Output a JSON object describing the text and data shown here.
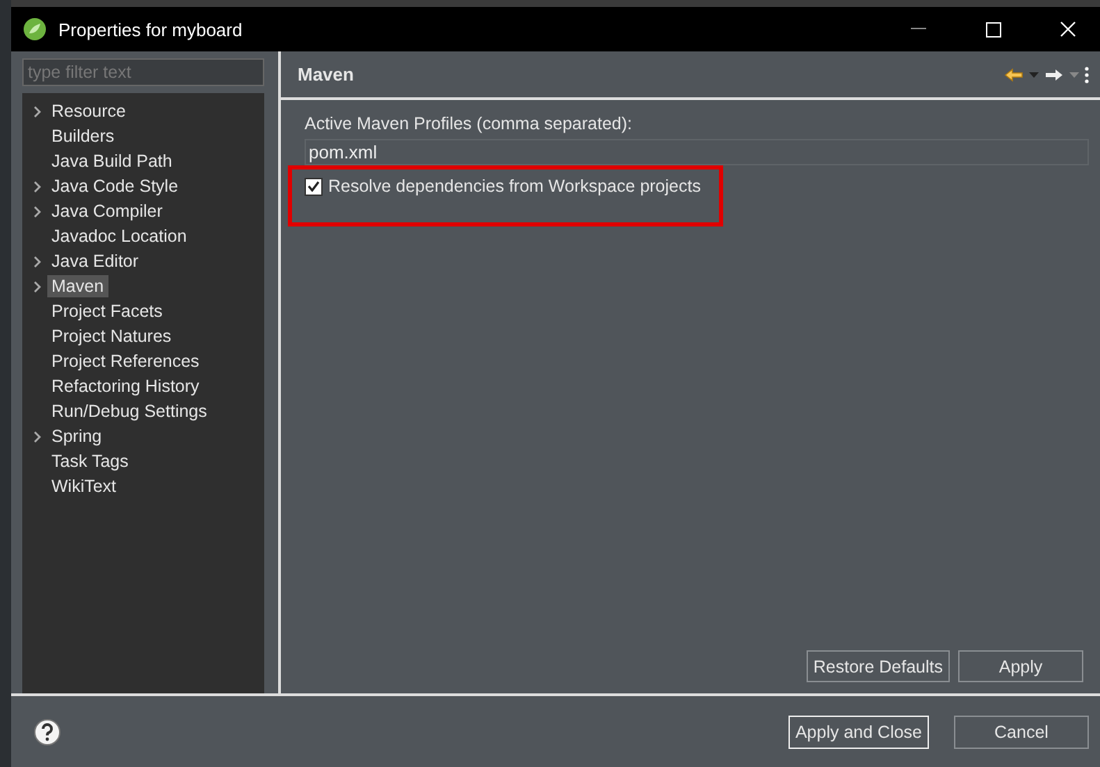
{
  "window": {
    "title": "Properties for myboard"
  },
  "filter": {
    "placeholder": "type filter text"
  },
  "tree": [
    {
      "label": "Resource",
      "expandable": true,
      "selected": false
    },
    {
      "label": "Builders",
      "expandable": false,
      "selected": false
    },
    {
      "label": "Java Build Path",
      "expandable": false,
      "selected": false
    },
    {
      "label": "Java Code Style",
      "expandable": true,
      "selected": false
    },
    {
      "label": "Java Compiler",
      "expandable": true,
      "selected": false
    },
    {
      "label": "Javadoc Location",
      "expandable": false,
      "selected": false
    },
    {
      "label": "Java Editor",
      "expandable": true,
      "selected": false
    },
    {
      "label": "Maven",
      "expandable": true,
      "selected": true
    },
    {
      "label": "Project Facets",
      "expandable": false,
      "selected": false
    },
    {
      "label": "Project Natures",
      "expandable": false,
      "selected": false
    },
    {
      "label": "Project References",
      "expandable": false,
      "selected": false
    },
    {
      "label": "Refactoring History",
      "expandable": false,
      "selected": false
    },
    {
      "label": "Run/Debug Settings",
      "expandable": false,
      "selected": false
    },
    {
      "label": "Spring",
      "expandable": true,
      "selected": false
    },
    {
      "label": "Task Tags",
      "expandable": false,
      "selected": false
    },
    {
      "label": "WikiText",
      "expandable": false,
      "selected": false
    }
  ],
  "page": {
    "title": "Maven",
    "profiles_label": "Active Maven Profiles (comma separated):",
    "profiles_value": "pom.xml",
    "resolve_checkbox": {
      "label": "Resolve dependencies from Workspace projects",
      "checked": true
    }
  },
  "page_buttons": [
    "Restore Defaults",
    "Apply"
  ],
  "dialog_buttons": [
    {
      "label": "Apply and Close",
      "default": true
    },
    {
      "label": "Cancel",
      "default": false
    }
  ]
}
